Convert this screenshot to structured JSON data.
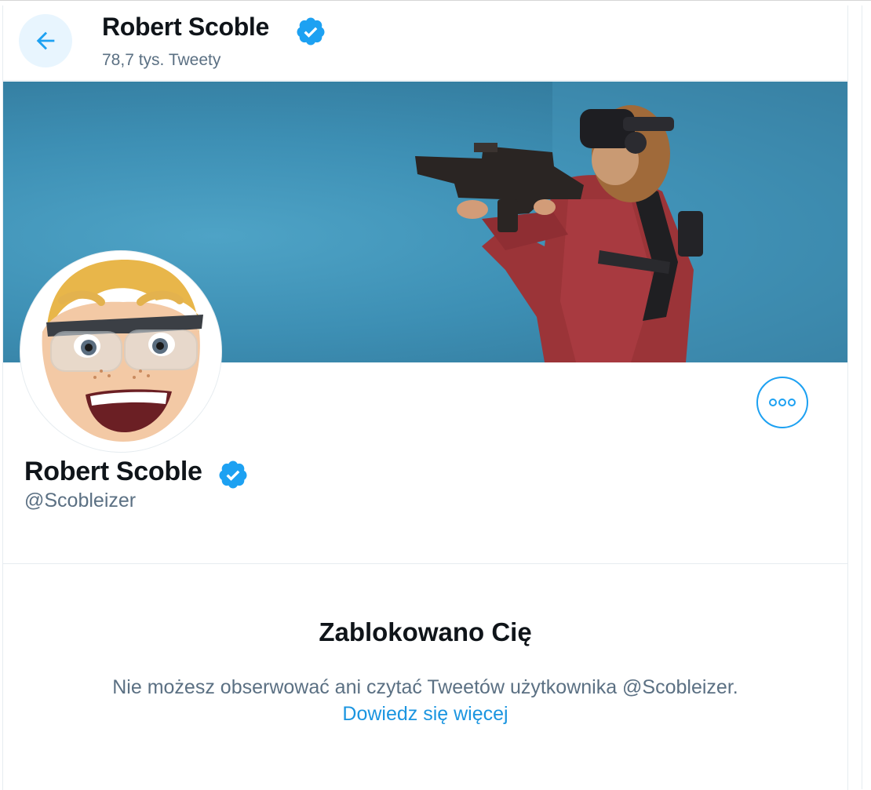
{
  "header": {
    "name": "Robert Scoble",
    "tweet_count": "78,7 tys. Tweety",
    "back_icon": "arrow-left-icon",
    "verified_icon": "verified-badge-icon"
  },
  "profile": {
    "name": "Robert Scoble",
    "handle": "@Scobleizer",
    "more_icon": "more-dots-icon"
  },
  "blocked": {
    "title": "Zablokowano Cię",
    "message": "Nie możesz obserwować ani czytać Tweetów użytkownika @Scobleizer.",
    "link": "Dowiedz się więcej"
  },
  "colors": {
    "accent": "#1da1f2",
    "link": "#1b95e0",
    "secondary_text": "#5b7083",
    "back_button_bg": "#e8f5fe"
  }
}
